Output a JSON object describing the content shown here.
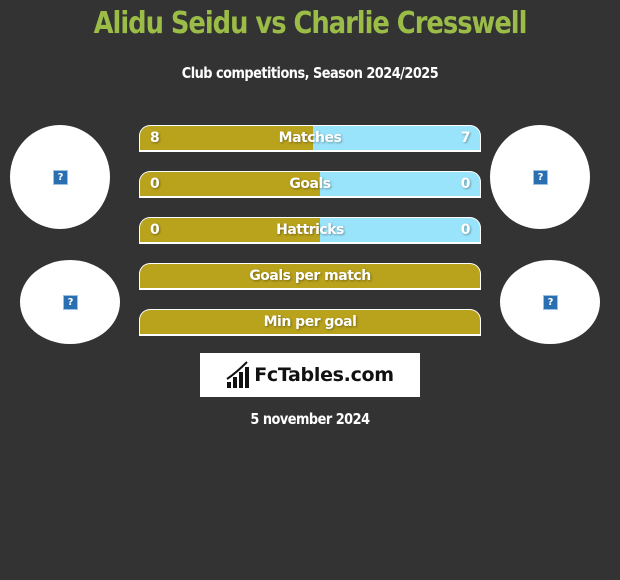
{
  "header": {
    "title": "Alidu Seidu vs Charlie Cresswell",
    "subtitle": "Club competitions, Season 2024/2025"
  },
  "players": {
    "left": {
      "name": "Alidu Seidu",
      "photo_icon": "broken-image-icon",
      "club_icon": "broken-image-icon"
    },
    "right": {
      "name": "Charlie Cresswell",
      "photo_icon": "broken-image-icon",
      "club_icon": "broken-image-icon"
    }
  },
  "colors": {
    "title": "#9bbd47",
    "left_bar": "#b9a21c",
    "right_bar": "#9ae4fb",
    "background": "#333333"
  },
  "stats": [
    {
      "label": "Matches",
      "left": "8",
      "right": "7",
      "left_share": 0.51
    },
    {
      "label": "Goals",
      "left": "0",
      "right": "0",
      "left_share": 0.53
    },
    {
      "label": "Hattricks",
      "left": "0",
      "right": "0",
      "left_share": 0.53
    },
    {
      "label": "Goals per match",
      "left": "",
      "right": "",
      "left_share": 1
    },
    {
      "label": "Min per goal",
      "left": "",
      "right": "",
      "left_share": 1
    }
  ],
  "logo": {
    "text": "FcTables.com",
    "icon": "bar-chart-icon"
  },
  "footer": {
    "date": "5 november 2024"
  },
  "icon_glyph": "?"
}
